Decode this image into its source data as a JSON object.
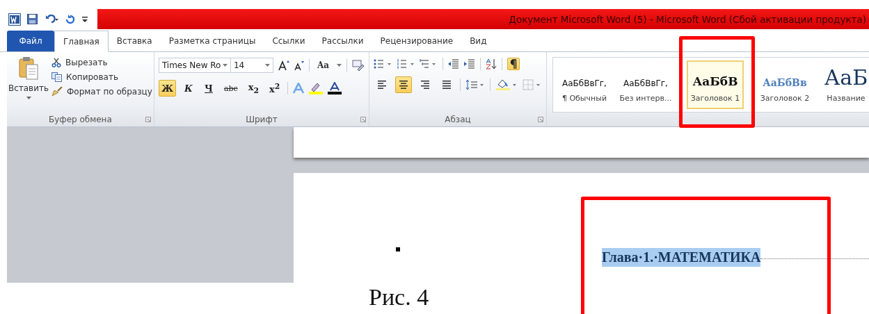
{
  "window": {
    "title": "Документ Microsoft Word (5)  -  Microsoft Word (Сбой активации продукта)"
  },
  "tabs": [
    {
      "label": "Файл",
      "kind": "file",
      "selected": false
    },
    {
      "label": "Главная",
      "kind": "tab",
      "selected": true
    },
    {
      "label": "Вставка",
      "kind": "tab",
      "selected": false
    },
    {
      "label": "Разметка страницы",
      "kind": "tab",
      "selected": false
    },
    {
      "label": "Ссылки",
      "kind": "tab",
      "selected": false
    },
    {
      "label": "Рассылки",
      "kind": "tab",
      "selected": false
    },
    {
      "label": "Рецензирование",
      "kind": "tab",
      "selected": false
    },
    {
      "label": "Вид",
      "kind": "tab",
      "selected": false
    }
  ],
  "clipboard": {
    "paste": "Вставить",
    "actions": [
      {
        "label": "Вырезать",
        "kind": "cut"
      },
      {
        "label": "Копировать",
        "kind": "copy"
      },
      {
        "label": "Формат по образцу",
        "kind": "brush"
      }
    ],
    "label": "Буфер обмена"
  },
  "font": {
    "name": "Times New Ro",
    "size": "14",
    "case_button": "Aa",
    "format_buttons": [
      {
        "label": "Ж",
        "kind": "bold",
        "selected": true
      },
      {
        "label": "К",
        "kind": "italic",
        "selected": false
      },
      {
        "label": "Ч",
        "kind": "underline",
        "selected": false
      },
      {
        "label": "abc",
        "kind": "strike",
        "selected": false
      },
      {
        "label": "x$_{2}$",
        "kind": "sub",
        "selected": false
      },
      {
        "label": "x$^{2}$",
        "kind": "sup",
        "selected": false
      }
    ],
    "label": "Шрифт"
  },
  "paragraph": {
    "show_marks": true,
    "alignment": [
      {
        "kind": "left",
        "selected": false
      },
      {
        "kind": "center",
        "selected": true
      },
      {
        "kind": "right",
        "selected": false
      },
      {
        "kind": "justify",
        "selected": false
      }
    ],
    "label": "Абзац"
  },
  "styles": [
    {
      "preview": "АаБбВвГг,",
      "name": "¶ Обычный",
      "kind": "normal",
      "selected": false
    },
    {
      "preview": "АаБбВвГг,",
      "name": "Без интерв...",
      "kind": "normal",
      "selected": false
    },
    {
      "preview": "АаБбВ",
      "name": "Заголовок 1",
      "kind": "h1",
      "selected": true
    },
    {
      "preview": "АаБбВв",
      "name": "Заголовок 2",
      "kind": "h2",
      "selected": false
    },
    {
      "preview": "АаБ",
      "name": "Название",
      "kind": "title",
      "selected": false
    }
  ],
  "document": {
    "heading": "Глава·1.·МАТЕМАТИКА",
    "heading_selected": true
  },
  "caption": "Рис. 4"
}
